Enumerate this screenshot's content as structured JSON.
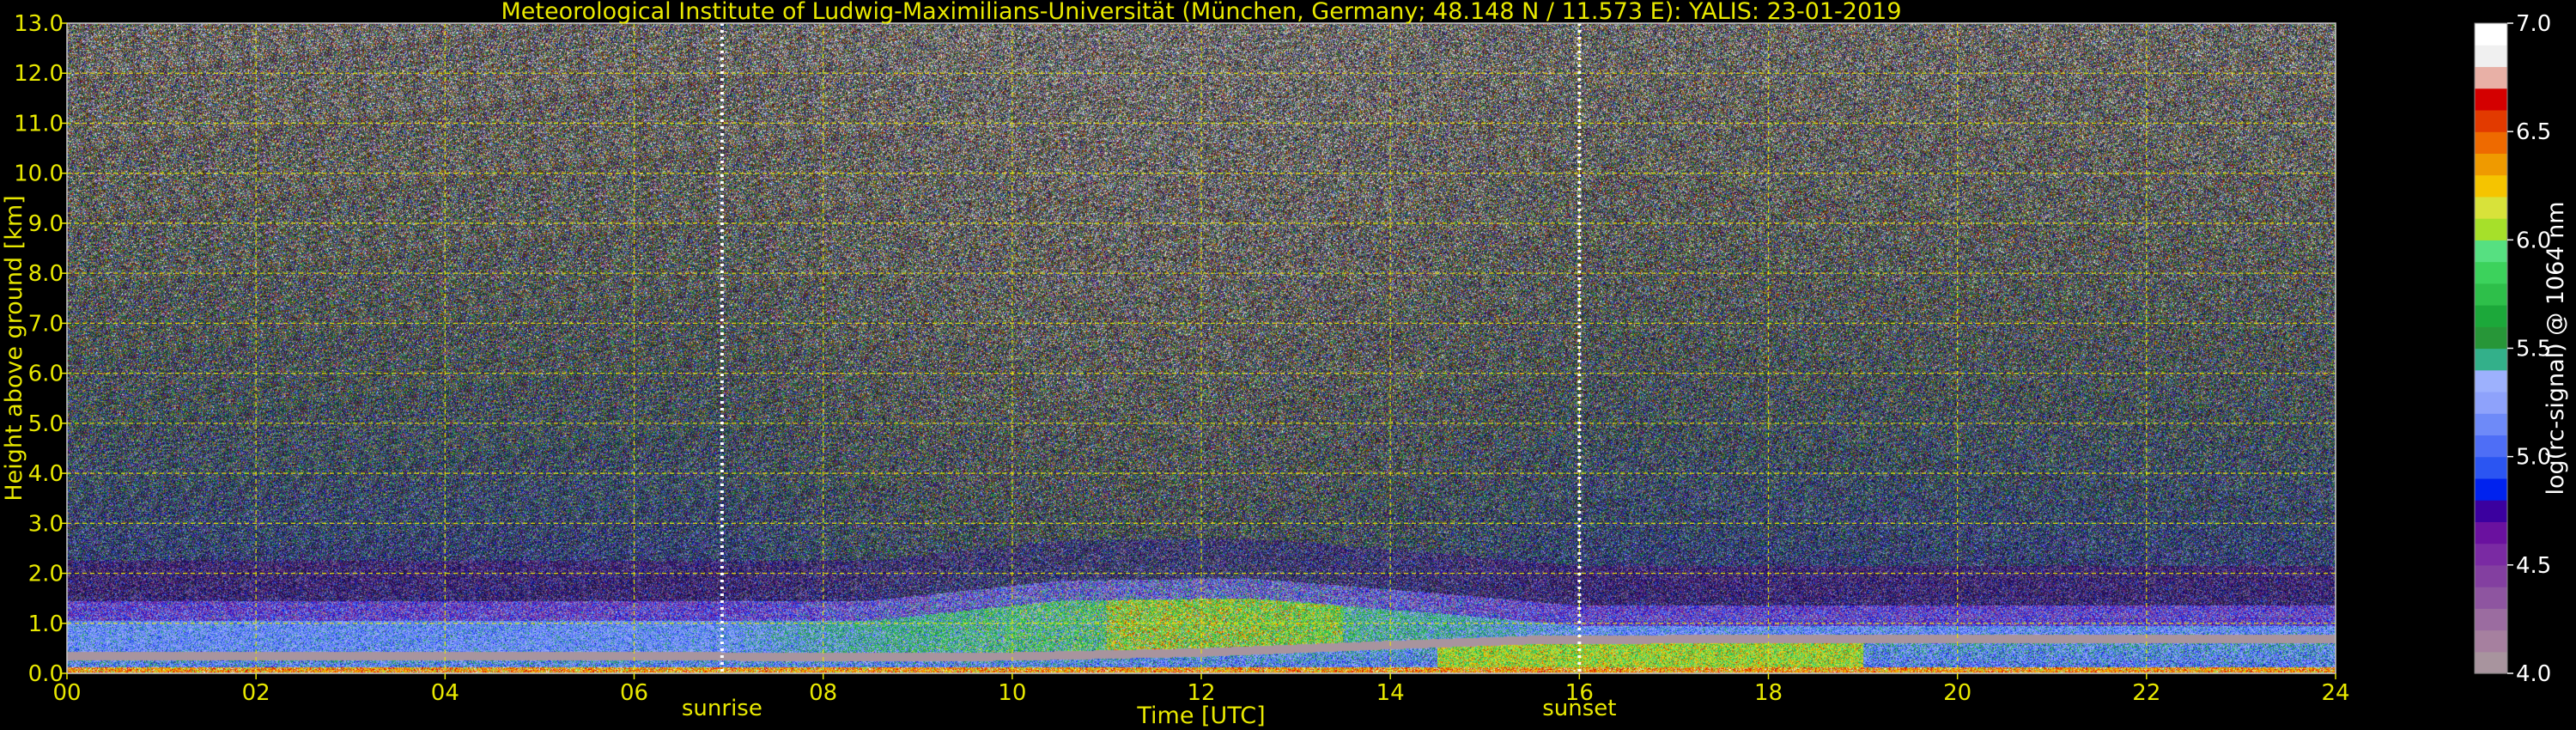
{
  "chart_data": {
    "type": "heatmap",
    "title": "Meteorological Institute of Ludwig-Maximilians-Universität (München, Germany; 48.148 N / 11.573 E):    YALIS: 23-01-2019",
    "xlabel": "Time [UTC]",
    "ylabel": "Height above ground [km]",
    "xlim": [
      0,
      24
    ],
    "ylim": [
      0,
      13
    ],
    "x_tick_values": [
      0,
      2,
      4,
      6,
      8,
      10,
      12,
      14,
      16,
      18,
      20,
      22,
      24
    ],
    "x_tick_labels": [
      "00",
      "02",
      "04",
      "06",
      "08",
      "10",
      "12",
      "14",
      "16",
      "18",
      "20",
      "22",
      "24"
    ],
    "y_tick_values": [
      0,
      1,
      2,
      3,
      4,
      5,
      6,
      7,
      8,
      9,
      10,
      11,
      12,
      13
    ],
    "y_tick_labels": [
      "0.0",
      "1.0",
      "2.0",
      "3.0",
      "4.0",
      "5.0",
      "6.0",
      "7.0",
      "8.0",
      "9.0",
      "10.0",
      "11.0",
      "12.0",
      "13.0"
    ],
    "grid": true,
    "colorbar": {
      "label": "log(rc-signal) @ 1064 nm",
      "range": [
        4.0,
        7.0
      ],
      "tick_values": [
        4.0,
        4.5,
        5.0,
        5.5,
        6.0,
        6.5,
        7.0
      ],
      "tick_labels": [
        "4.0",
        "4.5",
        "5.0",
        "5.5",
        "6.0",
        "6.5",
        "7.0"
      ],
      "colors": [
        "#a8949e",
        "#a6809f",
        "#9b6ca0",
        "#8e55a0",
        "#833fa0",
        "#7a2aa3",
        "#6a119f",
        "#3b009f",
        "#0022ee",
        "#2b55f2",
        "#4e6ef6",
        "#6e8af8",
        "#8ea2fb",
        "#9db1fd",
        "#33b08a",
        "#279638",
        "#1ca83a",
        "#2ebf4a",
        "#3cd25c",
        "#56e081",
        "#a6e02a",
        "#d8e23a",
        "#f5c400",
        "#ef9a00",
        "#ee6a00",
        "#e23a00",
        "#d40000",
        "#e8b0a6",
        "#f0f0f0",
        "#ffffff"
      ]
    },
    "annotations": [
      {
        "text": "sunrise",
        "x": 6.93
      },
      {
        "text": "sunset",
        "x": 16.0
      }
    ],
    "features": {
      "aerosol_layer_top_km": [
        {
          "x": 0,
          "y": 1.05
        },
        {
          "x": 6.9,
          "y": 1.05
        },
        {
          "x": 8.5,
          "y": 1.05
        },
        {
          "x": 10.5,
          "y": 1.45
        },
        {
          "x": 12.5,
          "y": 1.5
        },
        {
          "x": 14.5,
          "y": 1.2
        },
        {
          "x": 16,
          "y": 0.95
        },
        {
          "x": 24,
          "y": 0.95
        }
      ],
      "boundary_layer_km": [
        {
          "x": 0,
          "y": 0.38
        },
        {
          "x": 6,
          "y": 0.38
        },
        {
          "x": 8,
          "y": 0.36
        },
        {
          "x": 10,
          "y": 0.37
        },
        {
          "x": 12,
          "y": 0.45
        },
        {
          "x": 14,
          "y": 0.6
        },
        {
          "x": 15.5,
          "y": 0.7
        },
        {
          "x": 17.5,
          "y": 0.72
        },
        {
          "x": 24,
          "y": 0.72
        }
      ]
    }
  }
}
